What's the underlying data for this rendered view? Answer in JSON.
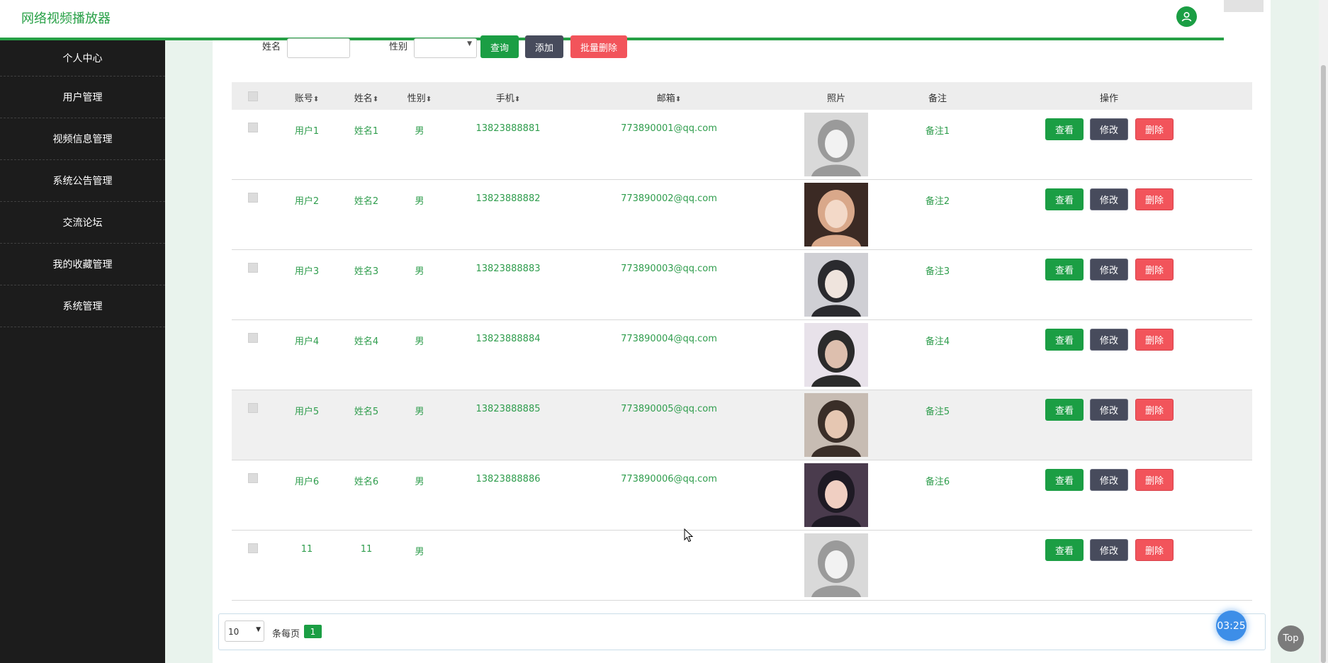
{
  "app": {
    "title": "网络视频播放器"
  },
  "sidebar": {
    "items": [
      {
        "label": "个人中心"
      },
      {
        "label": "用户管理"
      },
      {
        "label": "视频信息管理"
      },
      {
        "label": "系统公告管理"
      },
      {
        "label": "交流论坛"
      },
      {
        "label": "我的收藏管理"
      },
      {
        "label": "系统管理"
      }
    ]
  },
  "search": {
    "name_label": "姓名",
    "name_value": "",
    "gender_label": "性别",
    "gender_value": "",
    "query_label": "查询",
    "add_label": "添加",
    "batch_delete_label": "批量删除"
  },
  "table": {
    "headers": {
      "account": "账号",
      "name": "姓名",
      "gender": "性别",
      "phone": "手机",
      "email": "邮箱",
      "photo": "照片",
      "note": "备注",
      "actions": "操作"
    },
    "sort_icon": "⬍",
    "action_labels": {
      "view": "查看",
      "edit": "修改",
      "delete": "删除"
    },
    "rows": [
      {
        "account": "用户1",
        "name": "姓名1",
        "gender": "男",
        "phone": "13823888881",
        "email": "773890001@qq.com",
        "note": "备注1"
      },
      {
        "account": "用户2",
        "name": "姓名2",
        "gender": "男",
        "phone": "13823888882",
        "email": "773890002@qq.com",
        "note": "备注2"
      },
      {
        "account": "用户3",
        "name": "姓名3",
        "gender": "男",
        "phone": "13823888883",
        "email": "773890003@qq.com",
        "note": "备注3"
      },
      {
        "account": "用户4",
        "name": "姓名4",
        "gender": "男",
        "phone": "13823888884",
        "email": "773890004@qq.com",
        "note": "备注4"
      },
      {
        "account": "用户5",
        "name": "姓名5",
        "gender": "男",
        "phone": "13823888885",
        "email": "773890005@qq.com",
        "note": "备注5"
      },
      {
        "account": "用户6",
        "name": "姓名6",
        "gender": "男",
        "phone": "13823888886",
        "email": "773890006@qq.com",
        "note": "备注6"
      },
      {
        "account": "11",
        "name": "11",
        "gender": "男",
        "phone": "",
        "email": "",
        "note": ""
      }
    ]
  },
  "pagination": {
    "page_size": "10",
    "per_page_label": "条每页",
    "current_page": "1"
  },
  "overlay": {
    "timer": "03:25",
    "top_label": "Top"
  },
  "colors": {
    "accent": "#27a046",
    "sidebar_bg": "#1c1c1c",
    "danger": "#f2545b",
    "neutral": "#474b5c"
  }
}
